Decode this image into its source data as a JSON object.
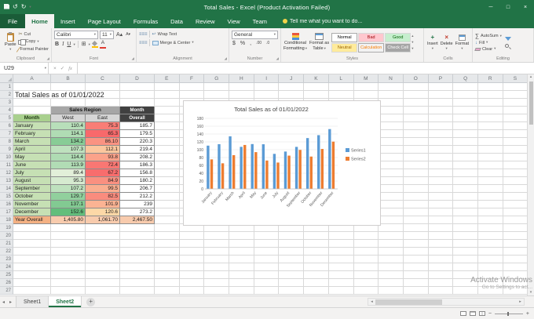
{
  "title_bar": {
    "title": "Total Sales - Excel (Product Activation Failed)"
  },
  "ribbon_tabs": [
    {
      "label": "File",
      "file": true
    },
    {
      "label": "Home",
      "active": true
    },
    {
      "label": "Insert"
    },
    {
      "label": "Page Layout"
    },
    {
      "label": "Formulas"
    },
    {
      "label": "Data"
    },
    {
      "label": "Review"
    },
    {
      "label": "View"
    },
    {
      "label": "Team"
    },
    {
      "label": "Tell me what you want to do...",
      "tellme": true
    }
  ],
  "ribbon": {
    "clipboard": {
      "title": "Clipboard",
      "paste": "Paste",
      "cut": "Cut",
      "copy": "Copy",
      "painter": "Format Painter"
    },
    "font": {
      "title": "Font",
      "name": "Calibri",
      "size": "11"
    },
    "alignment": {
      "title": "Alignment",
      "wrap": "Wrap Text",
      "merge": "Merge & Center"
    },
    "number": {
      "title": "Number",
      "format": "General"
    },
    "styles": {
      "title": "Styles",
      "cf1": "Conditional",
      "cf2": "Formatting",
      "ft1": "Format as",
      "ft2": "Table",
      "cell_styles": [
        {
          "label": "Normal",
          "bg": "#ffffff",
          "fg": "#000000"
        },
        {
          "label": "Bad",
          "bg": "#ffc7ce",
          "fg": "#9c0006"
        },
        {
          "label": "Good",
          "bg": "#c6efce",
          "fg": "#006100"
        },
        {
          "label": "Neutral",
          "bg": "#ffeb9c",
          "fg": "#9c6500"
        },
        {
          "label": "Calculation",
          "bg": "#f2f2f2",
          "fg": "#fa7d00"
        },
        {
          "label": "Check Cell",
          "bg": "#a5a5a5",
          "fg": "#ffffff"
        }
      ]
    },
    "cells": {
      "title": "Cells",
      "insert": "Insert",
      "delete": "Delete",
      "format": "Format"
    },
    "editing": {
      "title": "Editing",
      "autosum": "AutoSum",
      "fill": "Fill",
      "clear": "Clear"
    }
  },
  "formula_bar": {
    "name_box": "U29"
  },
  "sheet": {
    "columns": [
      "A",
      "B",
      "C",
      "D",
      "E",
      "F",
      "G",
      "H",
      "I",
      "J",
      "K",
      "L",
      "M",
      "N",
      "O",
      "P",
      "Q",
      "R",
      "S"
    ],
    "visible_rows": 27,
    "title_cell": "Total Sales as of 01/01/2022",
    "header": {
      "sales_region": "Sales Region",
      "month": "Month",
      "west": "West",
      "east": "East",
      "overall_top": "Month",
      "overall_bottom": "Overall"
    },
    "month_bg": "#c6e0b4",
    "rows": [
      {
        "month": "January",
        "west": "110.4",
        "east": "75.3",
        "overall": "185.7",
        "west_bg": "#b8dfba",
        "east_bg": "#f97d76"
      },
      {
        "month": "February",
        "west": "114.1",
        "east": "65.3",
        "overall": "179.5",
        "west_bg": "#b0dcb4",
        "east_bg": "#f8696b"
      },
      {
        "month": "March",
        "west": "134.2",
        "east": "86.10",
        "overall": "220.3",
        "west_bg": "#88cc96",
        "east_bg": "#fa9382"
      },
      {
        "month": "April",
        "west": "107.3",
        "east": "112.1",
        "overall": "219.4",
        "west_bg": "#bee1be",
        "east_bg": "#fcc79e"
      },
      {
        "month": "May",
        "west": "114.4",
        "east": "93.8",
        "overall": "208.2",
        "west_bg": "#afdbb3",
        "east_bg": "#fba28a"
      },
      {
        "month": "June",
        "west": "113.9",
        "east": "72.4",
        "overall": "186.3",
        "west_bg": "#b1dcb5",
        "east_bg": "#f97773"
      },
      {
        "month": "July",
        "west": "89.4",
        "east": "67.2",
        "overall": "156.8",
        "west_bg": "#e2efd9",
        "east_bg": "#f86d6d"
      },
      {
        "month": "August",
        "west": "95.3",
        "east": "84.9",
        "overall": "180.2",
        "west_bg": "#d6ead0",
        "east_bg": "#fa9080"
      },
      {
        "month": "September",
        "west": "107.2",
        "east": "99.5",
        "overall": "206.7",
        "west_bg": "#bee1be",
        "east_bg": "#fbae90"
      },
      {
        "month": "October",
        "west": "129.7",
        "east": "82.5",
        "overall": "212.2",
        "west_bg": "#91d09d",
        "east_bg": "#fa8c7e"
      },
      {
        "month": "November",
        "west": "137.1",
        "east": "101.9",
        "overall": "239",
        "west_bg": "#82ca92",
        "east_bg": "#fbb393"
      },
      {
        "month": "December",
        "west": "152.6",
        "east": "120.6",
        "overall": "273.2",
        "west_bg": "#63be7b",
        "east_bg": "#fdd8a7"
      }
    ],
    "total": {
      "label": "Year Overall",
      "west": "1,405.80",
      "east": "1,061.70",
      "overall": "2,467.50",
      "label_bg": "#f4b183",
      "value_bg": "#f8cbad"
    }
  },
  "chart_data": {
    "type": "bar",
    "title": "Total Sales as of 01/01/2022",
    "categories": [
      "January",
      "February",
      "March",
      "April",
      "May",
      "June",
      "July",
      "August",
      "September",
      "October",
      "November",
      "December"
    ],
    "series": [
      {
        "name": "Series1",
        "color": "#5b9bd5",
        "values": [
          110.4,
          114.1,
          134.2,
          107.3,
          114.4,
          113.9,
          89.4,
          95.3,
          107.2,
          129.7,
          137.1,
          152.6
        ]
      },
      {
        "name": "Series2",
        "color": "#ed7d31",
        "values": [
          75.3,
          65.3,
          86.1,
          112.1,
          93.8,
          72.4,
          67.2,
          84.9,
          99.5,
          82.5,
          101.9,
          120.6
        ]
      }
    ],
    "xlabel": "",
    "ylabel": "",
    "ylim": [
      0,
      180
    ],
    "ytick_step": 20,
    "grid": true,
    "legend_position": "right"
  },
  "tabs_bar": {
    "sheets": [
      {
        "label": "Sheet1"
      },
      {
        "label": "Sheet2",
        "active": true
      }
    ]
  },
  "watermark": {
    "line1": "Activate Windows",
    "line2": "Go to Settings to act..."
  }
}
